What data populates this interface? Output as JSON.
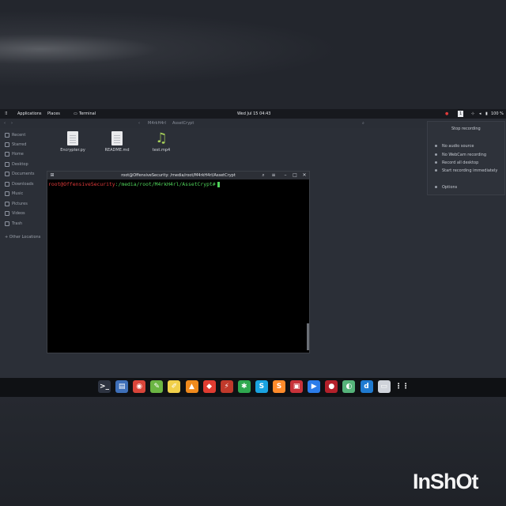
{
  "topbar": {
    "applications": "Applications",
    "places": "Places",
    "terminal": "Terminal",
    "datetime": "Wed Jul 15  04:43",
    "workspace": "1",
    "battery": "100 %"
  },
  "filemanager": {
    "path_parent": "M4rkH4rl",
    "path_current": "AssetCrypt",
    "sidebar": [
      "Recent",
      "Starred",
      "Home",
      "Desktop",
      "Documents",
      "Downloads",
      "Music",
      "Pictures",
      "Videos",
      "Trash",
      "+ Other Locations"
    ],
    "files": [
      {
        "name": "Encrypter.py",
        "icon": "document-icon"
      },
      {
        "name": "README.md",
        "icon": "document-icon"
      },
      {
        "name": "test.mp4",
        "icon": "music-note-icon"
      }
    ]
  },
  "terminal": {
    "title": "root@OffensiveSecurity: /media/root/M4rkH4rl/AssetCrypt",
    "prompt_user": "root@OffensiveSecurity",
    "prompt_path": ":/media/root/M4rkH4rl/AssetCrypt#"
  },
  "recorder": {
    "stop_label": "Stop recording",
    "options": [
      "No audio source",
      "No WebCam recording",
      "Record all desktop",
      "Start recording immediately"
    ],
    "settings_label": "Options"
  },
  "dock": {
    "apps": [
      {
        "name": "terminal-app-icon",
        "color": "#2d3340",
        "glyph": ">_"
      },
      {
        "name": "files-app-icon",
        "color": "#3e6fb8",
        "glyph": "▤"
      },
      {
        "name": "chrome-app-icon",
        "color": "#d9453a",
        "glyph": "◉"
      },
      {
        "name": "leafpad-app-icon",
        "color": "#6bb543",
        "glyph": "✎"
      },
      {
        "name": "notes-app-icon",
        "color": "#f1d04a",
        "glyph": "✐"
      },
      {
        "name": "vlc-app-icon",
        "color": "#f08a1c",
        "glyph": "▲"
      },
      {
        "name": "anydesk-app-icon",
        "color": "#e03c31",
        "glyph": "◆"
      },
      {
        "name": "burp-app-icon",
        "color": "#c0392b",
        "glyph": "⚡"
      },
      {
        "name": "clover-app-icon",
        "color": "#2fa84f",
        "glyph": "✱"
      },
      {
        "name": "skype-app-icon",
        "color": "#1aa3e0",
        "glyph": "S"
      },
      {
        "name": "sublime-app-icon",
        "color": "#ff8b2b",
        "glyph": "S"
      },
      {
        "name": "screen-recorder-app-icon",
        "color": "#c8323a",
        "glyph": "▣"
      },
      {
        "name": "zoom-app-icon",
        "color": "#2b7ce9",
        "glyph": "▶"
      },
      {
        "name": "cherry-app-icon",
        "color": "#b3202a",
        "glyph": "●"
      },
      {
        "name": "maps-app-icon",
        "color": "#55b37a",
        "glyph": "◐"
      },
      {
        "name": "dict-app-icon",
        "color": "#1f7ad0",
        "glyph": "d"
      },
      {
        "name": "drive-app-icon",
        "color": "#cfd3da",
        "glyph": "▭"
      },
      {
        "name": "app-grid-icon",
        "color": "#0f1114",
        "glyph": "⋮⋮"
      }
    ]
  },
  "watermark": "InShOt"
}
